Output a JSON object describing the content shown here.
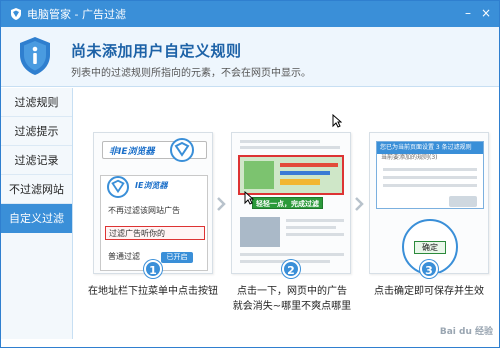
{
  "window": {
    "title": "电脑管家 - 广告过滤"
  },
  "header": {
    "title": "尚未添加用户自定义规则",
    "subtitle": "列表中的过滤规则所指向的元素，不会在网页中显示。"
  },
  "sidebar": {
    "items": [
      {
        "label": "过滤规则"
      },
      {
        "label": "过滤提示"
      },
      {
        "label": "过滤记录"
      },
      {
        "label": "不过滤网站"
      },
      {
        "label": "自定义过滤"
      }
    ],
    "active_index": 4
  },
  "steps": [
    {
      "number": "1",
      "caption": "在地址栏下拉菜单中点击按钮",
      "illustration": {
        "browser_name": "非IE浏览器",
        "inner_browser_name": "IE浏览器",
        "menu": [
          "不再过滤该网站广告",
          "过滤广告听你的",
          "普通过滤"
        ],
        "toggle_label": "已开启"
      }
    },
    {
      "number": "2",
      "caption_line1": "点击一下，网页中的广告",
      "caption_line2": "就会消失~哪里不爽点哪里",
      "illustration": {
        "ad_label": "轻轻一点，完成过滤"
      }
    },
    {
      "number": "3",
      "caption": "点击确定即可保存并生效",
      "illustration": {
        "dialog_title": "您已为当前页面设置 3 条过滤规则",
        "dialog_line": "当前要添加的规则(3)",
        "confirm_label": "确定"
      }
    }
  ],
  "watermark": "Bai du 经验",
  "colors": {
    "accent": "#3a8fd8",
    "header_title": "#1d62a7",
    "highlight": "#dd3333",
    "ad_green": "#2c9a3b"
  }
}
